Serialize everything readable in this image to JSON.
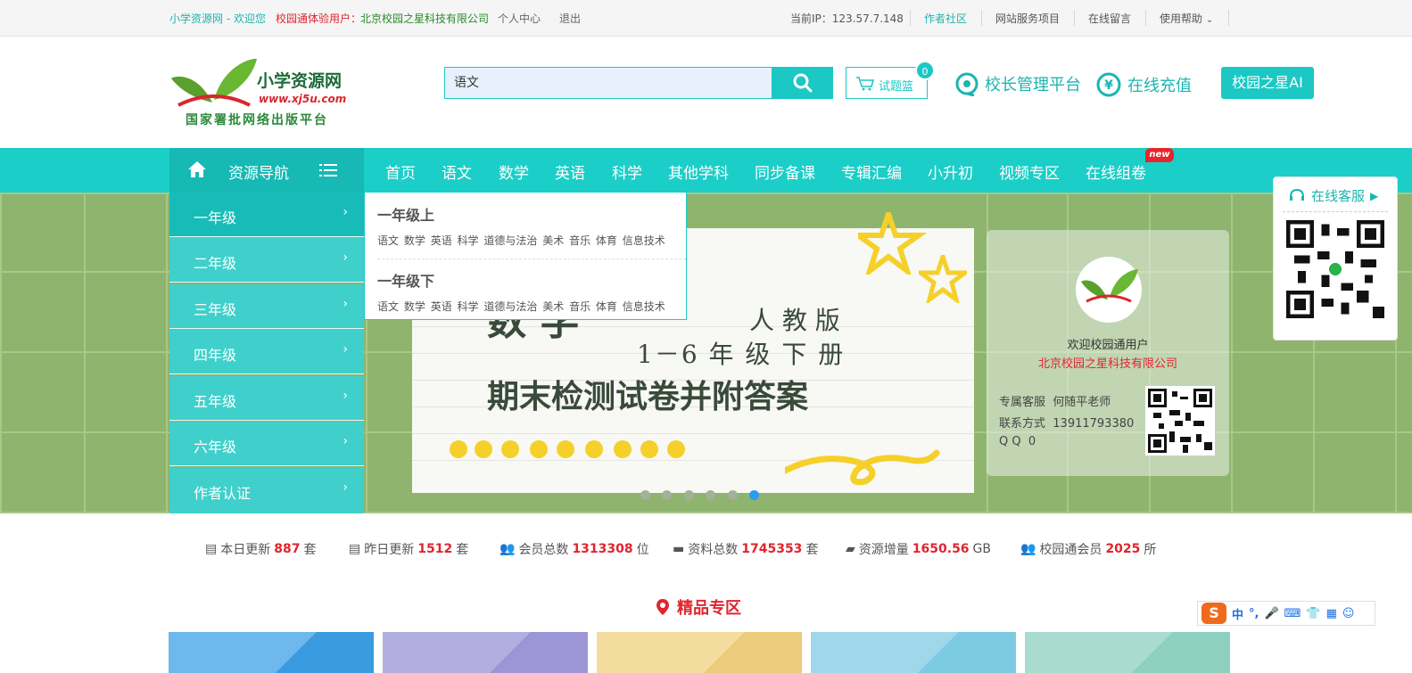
{
  "topbar": {
    "site_welcome": "小学资源网 - 欢迎您",
    "trial_user_prefix": "校园通体验用户：",
    "trial_user_org": "北京校园之星科技有限公司",
    "personal_center": "个人中心",
    "logout": "退出",
    "ip": "当前IP：123.57.7.148",
    "author_community": "作者社区",
    "service_items": "网站服务项目",
    "online_message": "在线留言",
    "help": "使用帮助"
  },
  "header": {
    "logo_title": "小学资源网",
    "logo_url": "www.xj5u.com",
    "logo_slogan": "国家署批网络出版平台",
    "search_value": "语文",
    "basket_label": "试题篮",
    "basket_count": "0",
    "principal_platform": "校长管理平台",
    "recharge": "在线充值",
    "ai_button": "校园之星AI"
  },
  "nav": {
    "resource_nav": "资源导航",
    "items": [
      "首页",
      "语文",
      "数学",
      "英语",
      "科学",
      "其他学科",
      "同步备课",
      "专辑汇编",
      "小升初",
      "视频专区",
      "在线组卷"
    ],
    "new_badge": "new"
  },
  "grades": [
    "一年级",
    "二年级",
    "三年级",
    "四年级",
    "五年级",
    "六年级",
    "作者认证"
  ],
  "dropdown": {
    "sections": [
      {
        "title": "一年级上",
        "subjects": [
          "语文",
          "数学",
          "英语",
          "科学",
          "道德与法治",
          "美术",
          "音乐",
          "体育",
          "信息技术"
        ]
      },
      {
        "title": "一年级下",
        "subjects": [
          "语文",
          "数学",
          "英语",
          "科学",
          "道德与法治",
          "美术",
          "音乐",
          "体育",
          "信息技术"
        ]
      }
    ]
  },
  "banner": {
    "subject": "数 学",
    "edition": "人 教 版",
    "grades": "1－6 年 级 下 册",
    "title": "期末检测试卷并附答案",
    "active_dot": 5
  },
  "welcome": {
    "greeting": "欢迎校园通用户",
    "org": "北京校园之星科技有限公司",
    "service_label": "专属客服",
    "service_name": "何随平老师",
    "contact_label": "联系方式",
    "contact_value": "13911793380",
    "qq_label": "Q Q",
    "qq_value": "0"
  },
  "service": {
    "label": "在线客服"
  },
  "stats": [
    {
      "label": "本日更新",
      "value": "887",
      "unit": "套"
    },
    {
      "label": "昨日更新",
      "value": "1512",
      "unit": "套"
    },
    {
      "label": "会员总数",
      "value": "1313308",
      "unit": "位"
    },
    {
      "label": "资料总数",
      "value": "1745353",
      "unit": "套"
    },
    {
      "label": "资源增量",
      "value": "1650.56",
      "unit": "GB"
    },
    {
      "label": "校园通会员",
      "value": "2025",
      "unit": "所"
    }
  ],
  "featured": {
    "title": "精品专区"
  },
  "ime": {
    "mode": "中"
  },
  "colors": {
    "accent": "#1bc8c3",
    "red": "#e0252e",
    "banner_green": "#8fb46e"
  }
}
